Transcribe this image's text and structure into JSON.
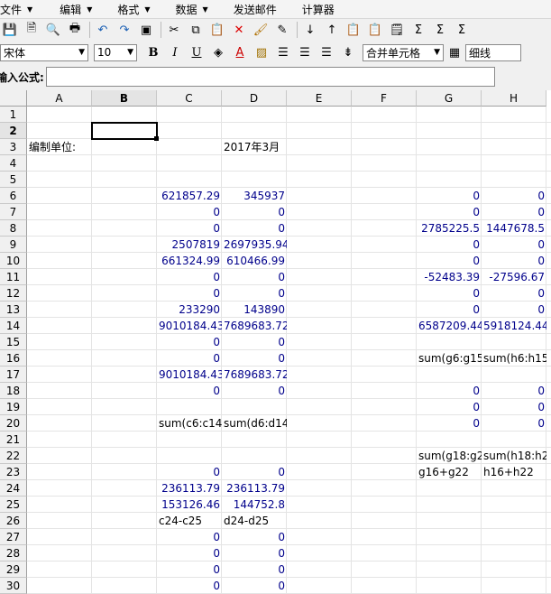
{
  "menu": [
    {
      "label": "文件",
      "arrow": true
    },
    {
      "label": "编辑",
      "arrow": true
    },
    {
      "label": "格式",
      "arrow": true
    },
    {
      "label": "数据",
      "arrow": true
    },
    {
      "label": "发送邮件",
      "arrow": false
    },
    {
      "label": "计算器",
      "arrow": false
    }
  ],
  "toolbar_icons": [
    "save-icon",
    "save-as-icon",
    "print-preview-icon",
    "print-icon",
    "undo-icon",
    "redo-icon",
    "select-all-icon",
    "cut-icon",
    "copy-icon",
    "paste-icon",
    "delete-icon",
    "format-painter-icon",
    "edit-icon",
    "sort-ascending-icon",
    "sort-descending-icon",
    "paste-special-icon",
    "paste-values-icon",
    "page-icon",
    "sum-icon",
    "sum-row-icon",
    "sum-col-icon"
  ],
  "format": {
    "font": "宋体",
    "size": "10",
    "bold": "B",
    "italic": "I",
    "underline": "U",
    "merge": "合并单元格",
    "border": "细线"
  },
  "formula_label": "输入公式:",
  "formula_value": "",
  "columns": [
    "A",
    "B",
    "C",
    "D",
    "E",
    "F",
    "G",
    "H"
  ],
  "active_column": "B",
  "active_row": "2",
  "rows": [
    {
      "r": "1",
      "cells": {}
    },
    {
      "r": "2",
      "cells": {}
    },
    {
      "r": "3",
      "cells": {
        "A": "编制单位:",
        "D": "2017年3月"
      }
    },
    {
      "r": "4",
      "cells": {}
    },
    {
      "r": "5",
      "cells": {}
    },
    {
      "r": "6",
      "cells": {
        "C": "621857.29",
        "D": "345937",
        "G": "0",
        "H": "0"
      }
    },
    {
      "r": "7",
      "cells": {
        "C": "0",
        "D": "0",
        "G": "0",
        "H": "0"
      }
    },
    {
      "r": "8",
      "cells": {
        "C": "0",
        "D": "0",
        "G": "2785225.5",
        "H": "1447678.5"
      }
    },
    {
      "r": "9",
      "cells": {
        "C": "2507819",
        "D": "2697935.94",
        "G": "0",
        "H": "0"
      }
    },
    {
      "r": "10",
      "cells": {
        "C": "661324.99",
        "D": "610466.99",
        "G": "0",
        "H": "0"
      }
    },
    {
      "r": "11",
      "cells": {
        "C": "0",
        "D": "0",
        "G": "-52483.39",
        "H": "-27596.67"
      }
    },
    {
      "r": "12",
      "cells": {
        "C": "0",
        "D": "0",
        "G": "0",
        "H": "0"
      }
    },
    {
      "r": "13",
      "cells": {
        "C": "233290",
        "D": "143890",
        "G": "0",
        "H": "0"
      }
    },
    {
      "r": "14",
      "cells": {
        "C": "9010184.43",
        "D": "7689683.72",
        "G": "6587209.44",
        "H": "5918124.44"
      }
    },
    {
      "r": "15",
      "cells": {
        "C": "0",
        "D": "0"
      }
    },
    {
      "r": "16",
      "cells": {
        "C": "0",
        "D": "0",
        "G": "sum(g6:g15",
        "H": "sum(h6:h15"
      }
    },
    {
      "r": "17",
      "cells": {
        "C": "9010184.43",
        "D": "7689683.72"
      }
    },
    {
      "r": "18",
      "cells": {
        "C": "0",
        "D": "0",
        "G": "0",
        "H": "0"
      }
    },
    {
      "r": "19",
      "cells": {
        "G": "0",
        "H": "0"
      }
    },
    {
      "r": "20",
      "cells": {
        "C": "sum(c6:c14",
        "D": "sum(d6:d14",
        "G": "0",
        "H": "0"
      }
    },
    {
      "r": "21",
      "cells": {}
    },
    {
      "r": "22",
      "cells": {
        "G": "sum(g18:g2",
        "H": "sum(h18:h2"
      }
    },
    {
      "r": "23",
      "cells": {
        "C": "0",
        "D": "0",
        "G": "g16+g22",
        "H": "h16+h22"
      }
    },
    {
      "r": "24",
      "cells": {
        "C": "236113.79",
        "D": "236113.79"
      }
    },
    {
      "r": "25",
      "cells": {
        "C": "153126.46",
        "D": "144752.8"
      }
    },
    {
      "r": "26",
      "cells": {
        "C": "c24-c25",
        "D": "d24-d25"
      }
    },
    {
      "r": "27",
      "cells": {
        "C": "0",
        "D": "0"
      }
    },
    {
      "r": "28",
      "cells": {
        "C": "0",
        "D": "0"
      }
    },
    {
      "r": "29",
      "cells": {
        "C": "0",
        "D": "0"
      }
    },
    {
      "r": "30",
      "cells": {
        "C": "0",
        "D": "0"
      }
    }
  ]
}
